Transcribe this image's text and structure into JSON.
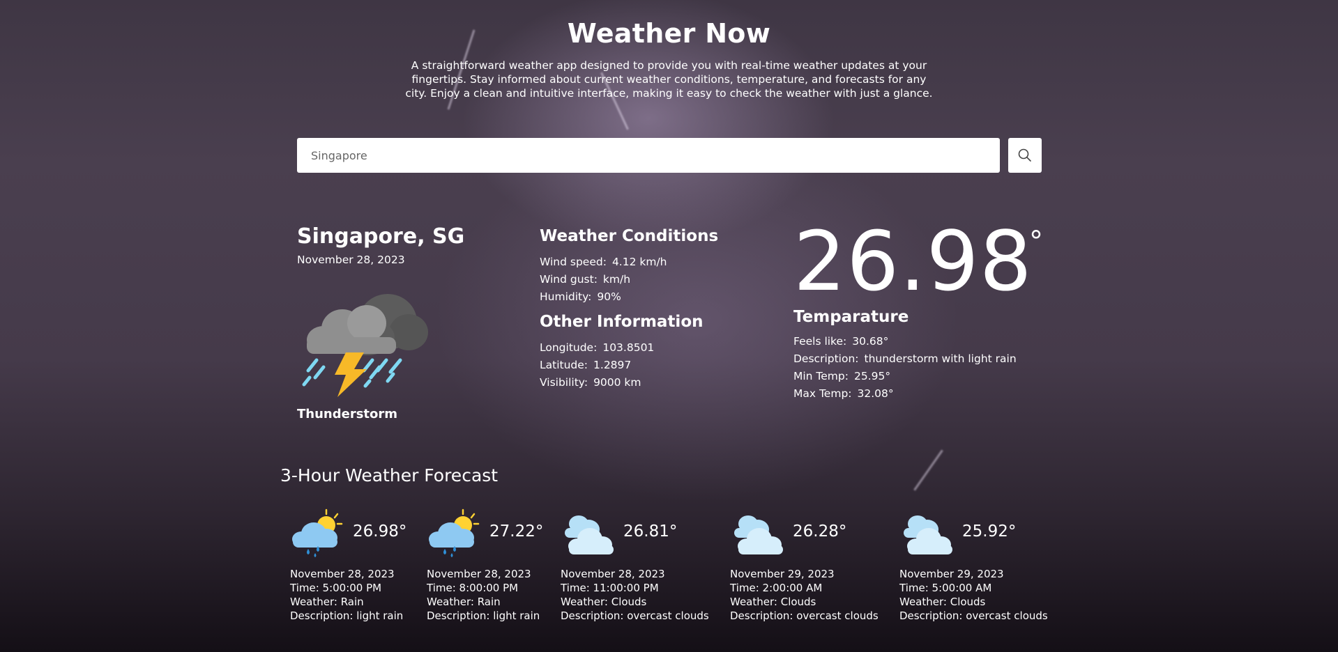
{
  "header": {
    "title": "Weather Now",
    "description": "A straightforward weather app designed to provide you with real-time weather updates at your fingertips. Stay informed about current weather conditions, temperature, and forecasts for any city. Enjoy a clean and intuitive interface, making it easy to check the weather with just a glance."
  },
  "search": {
    "value": "Singapore",
    "button_icon": "search-icon"
  },
  "current": {
    "city": "Singapore, SG",
    "date": "November 28, 2023",
    "icon": "thunderstorm-icon",
    "condition": "Thunderstorm",
    "conditions_title": "Weather Conditions",
    "wind_speed_label": "Wind speed:",
    "wind_speed": "4.12 km/h",
    "wind_gust_label": "Wind gust:",
    "wind_gust": "km/h",
    "humidity_label": "Humidity:",
    "humidity": "90%",
    "other_title": "Other Information",
    "longitude_label": "Longitude:",
    "longitude": "103.8501",
    "latitude_label": "Latitude:",
    "latitude": "1.2897",
    "visibility_label": "Visibility:",
    "visibility": "9000 km",
    "temperature": "26.98",
    "degree_symbol": "°",
    "temp_title": "Temparature",
    "feels_like_label": "Feels like:",
    "feels_like": "30.68°",
    "description_label": "Description:",
    "description": "thunderstorm with light rain",
    "min_temp_label": "Min Temp:",
    "min_temp": "25.95°",
    "max_temp_label": "Max Temp:",
    "max_temp": "32.08°"
  },
  "forecast": {
    "title": "3-Hour Weather Forecast",
    "items": [
      {
        "icon": "sun-cloud-rain-icon",
        "temp": "26.98°",
        "date": "November 28, 2023",
        "time": "Time: 5:00:00 PM",
        "weather": "Weather: Rain",
        "description": "Description: light rain"
      },
      {
        "icon": "sun-cloud-rain-icon",
        "temp": "27.22°",
        "date": "November 28, 2023",
        "time": "Time: 8:00:00 PM",
        "weather": "Weather: Rain",
        "description": "Description: light rain"
      },
      {
        "icon": "clouds-icon",
        "temp": "26.81°",
        "date": "November 28, 2023",
        "time": "Time: 11:00:00 PM",
        "weather": "Weather: Clouds",
        "description": "Description: overcast clouds"
      },
      {
        "icon": "clouds-icon",
        "temp": "26.28°",
        "date": "November 29, 2023",
        "time": "Time: 2:00:00 AM",
        "weather": "Weather: Clouds",
        "description": "Description: overcast clouds"
      },
      {
        "icon": "clouds-icon",
        "temp": "25.92°",
        "date": "November 29, 2023",
        "time": "Time: 5:00:00 AM",
        "weather": "Weather: Clouds",
        "description": "Description: overcast clouds"
      }
    ]
  },
  "colors": {
    "background": "#453a4a",
    "text": "#ffffff",
    "cloud_gray": "#8f8f8f",
    "cloud_dark": "#5c5c5c",
    "lightning": "#f7b928",
    "rain": "#7fd8f2",
    "sun": "#ffd233",
    "light_cloud": "#a8d8f5"
  }
}
